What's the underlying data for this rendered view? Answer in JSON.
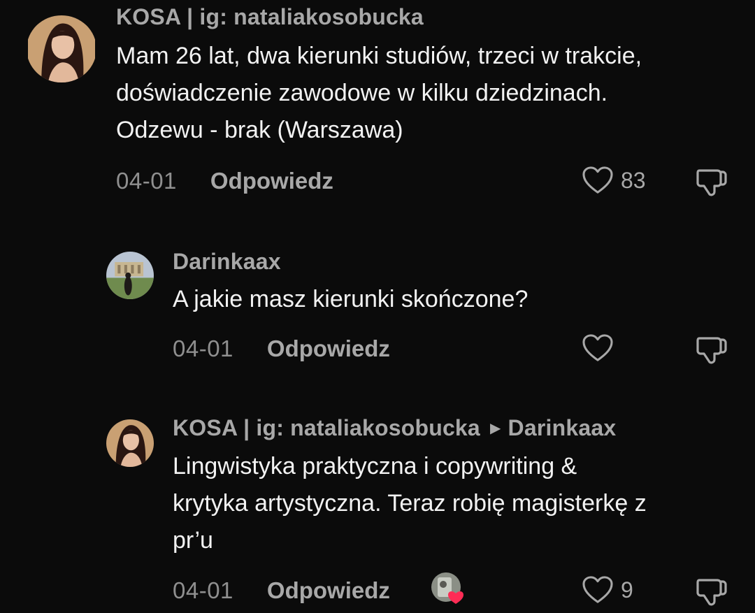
{
  "comments": [
    {
      "username": "KOSA | ig: nataliakosobucka",
      "text_lines": [
        "Mam 26 lat, dwa kierunki studiów, trzeci w trakcie,",
        "doświadczenie zawodowe w kilku dziedzinach.",
        "Odzewu - brak (Warszawa)"
      ],
      "date": "04-01",
      "reply_label": "Odpowiedz",
      "likes": "83"
    },
    {
      "username": "Darinkaax",
      "text_lines": [
        "A jakie masz kierunki skończone?"
      ],
      "date": "04-01",
      "reply_label": "Odpowiedz",
      "likes": ""
    },
    {
      "username": "KOSA | ig: nataliakosobucka",
      "reply_to": "Darinkaax",
      "text_lines": [
        "Lingwistyka praktyczna i copywriting &",
        "krytyka artystyczna. Teraz robię magisterkę z",
        "pr’u"
      ],
      "date": "04-01",
      "reply_label": "Odpowiedz",
      "likes": "9"
    }
  ],
  "colors": {
    "background": "#0b0b0b",
    "primary_text": "#f2f2f2",
    "secondary_text": "#a8a8a8",
    "creator_heart": "#fe2c55"
  },
  "icons": {
    "like": "heart-outline-icon",
    "dislike": "thumbs-down-outline-icon",
    "reply_arrow": "caret-right-icon",
    "creator_liked": "creator-liked-heart-badge"
  }
}
